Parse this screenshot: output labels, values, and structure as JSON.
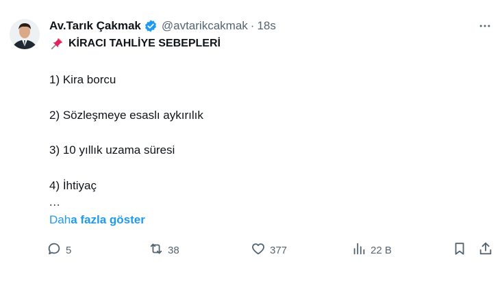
{
  "author": {
    "name": "Av.Tarık Çakmak",
    "handle": "@avtarikcakmak",
    "separator": "·",
    "time": "18s"
  },
  "post": {
    "pin_emoji_icon": "pushpin-icon",
    "title": "KİRACI TAHLİYE SEBEPLERİ",
    "items": [
      "1) Kira borcu",
      "2) Sözleşmeye esaslı aykırılık",
      "3) 10 yıllık uzama süresi",
      "4) İhtiyaç"
    ],
    "ellipsis": "...",
    "show_more_prefix": "Dah",
    "show_more_bold": "a fazla göster"
  },
  "actions": {
    "replies": "5",
    "reposts": "38",
    "likes": "377",
    "views": "22 B"
  },
  "colors": {
    "accent": "#1d9bf0",
    "text": "#0f1419",
    "muted": "#536471"
  }
}
